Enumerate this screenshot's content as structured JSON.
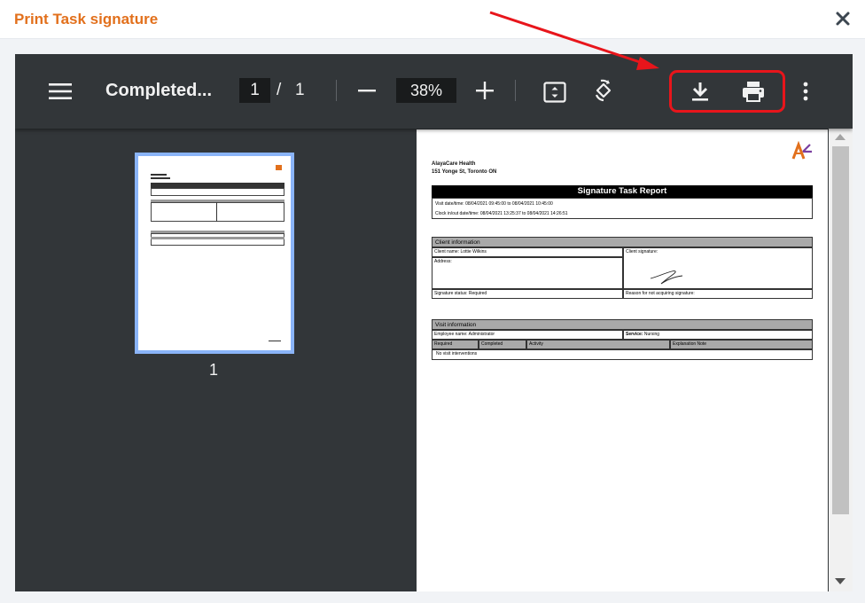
{
  "modal": {
    "title": "Print Task signature"
  },
  "toolbar": {
    "doc_title": "Completed...",
    "page_current": "1",
    "page_separator": "/",
    "page_total": "1",
    "zoom": "38%"
  },
  "thumbnail": {
    "page_number": "1"
  },
  "report": {
    "org_name": "AlayaCare Health",
    "org_address": "151 Yonge St, Toronto ON",
    "title": "Signature Task Report",
    "visit_datetime": "Visit date/time: 08/04/2021 09:45:00 to 08/04/2021 10:45:00",
    "clock_datetime": "Clock in/out date/time: 08/04/2021 13:25:37 to 08/04/2021 14:26:51",
    "client_section": "Client information",
    "client_name": "Client name: Lottie Wilkins",
    "client_signature": "Client signature:",
    "address": "Address:",
    "signature_status": "Signature status: Required",
    "reason": "Reason for not acquiring signature:",
    "visit_section": "Visit information",
    "employee_name": "Employee name: Administrator",
    "service_label": "Service:",
    "service_value": "Nursing",
    "columns": [
      "Required",
      "Completed",
      "Activity",
      "Explanation Note"
    ],
    "no_interventions": "No visit interventions"
  },
  "colors": {
    "title_orange": "#e2701c",
    "viewer_bg": "#323639",
    "highlight_red": "#e8151b"
  }
}
